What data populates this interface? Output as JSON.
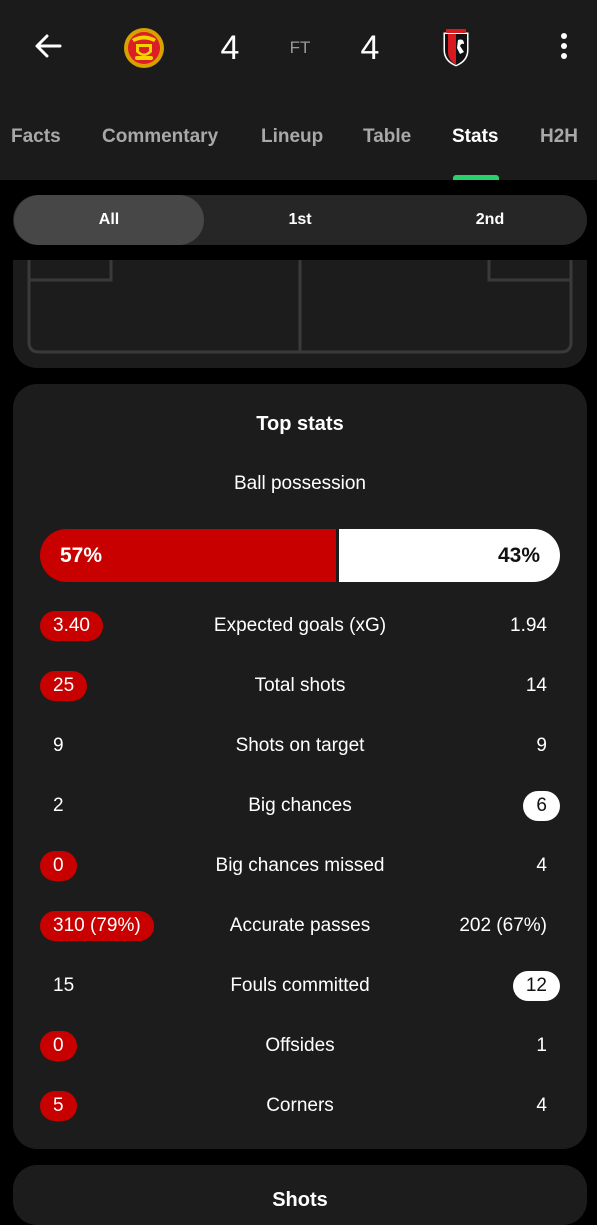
{
  "match": {
    "home_score": "4",
    "away_score": "4",
    "status": "FT",
    "home_crest_icon": "manchester-united-crest-icon",
    "away_crest_icon": "bournemouth-crest-icon"
  },
  "tabs": [
    {
      "label": "Facts"
    },
    {
      "label": "Commentary"
    },
    {
      "label": "Lineup"
    },
    {
      "label": "Table"
    },
    {
      "label": "Stats"
    },
    {
      "label": "H2H"
    }
  ],
  "periods": [
    {
      "label": "All"
    },
    {
      "label": "1st"
    },
    {
      "label": "2nd"
    }
  ],
  "top_stats": {
    "title": "Top stats",
    "possession": {
      "label": "Ball possession",
      "home": "57%",
      "away": "43%",
      "home_fraction": 0.57
    },
    "rows": [
      {
        "name": "Expected goals (xG)",
        "home": "3.40",
        "away": "1.94",
        "highlight": "home"
      },
      {
        "name": "Total shots",
        "home": "25",
        "away": "14",
        "highlight": "home"
      },
      {
        "name": "Shots on target",
        "home": "9",
        "away": "9",
        "highlight": "none"
      },
      {
        "name": "Big chances",
        "home": "2",
        "away": "6",
        "highlight": "away"
      },
      {
        "name": "Big chances missed",
        "home": "0",
        "away": "4",
        "highlight": "home"
      },
      {
        "name": "Accurate passes",
        "home": "310 (79%)",
        "away": "202 (67%)",
        "highlight": "home"
      },
      {
        "name": "Fouls committed",
        "home": "15",
        "away": "12",
        "highlight": "away"
      },
      {
        "name": "Offsides",
        "home": "0",
        "away": "1",
        "highlight": "home"
      },
      {
        "name": "Corners",
        "home": "5",
        "away": "4",
        "highlight": "home"
      }
    ]
  },
  "next_section": {
    "title": "Shots"
  },
  "colors": {
    "home": "#c90000",
    "away": "#ffffff",
    "tab_accent": "#28d16b",
    "background": "#000000",
    "card": "#1c1c1c"
  }
}
